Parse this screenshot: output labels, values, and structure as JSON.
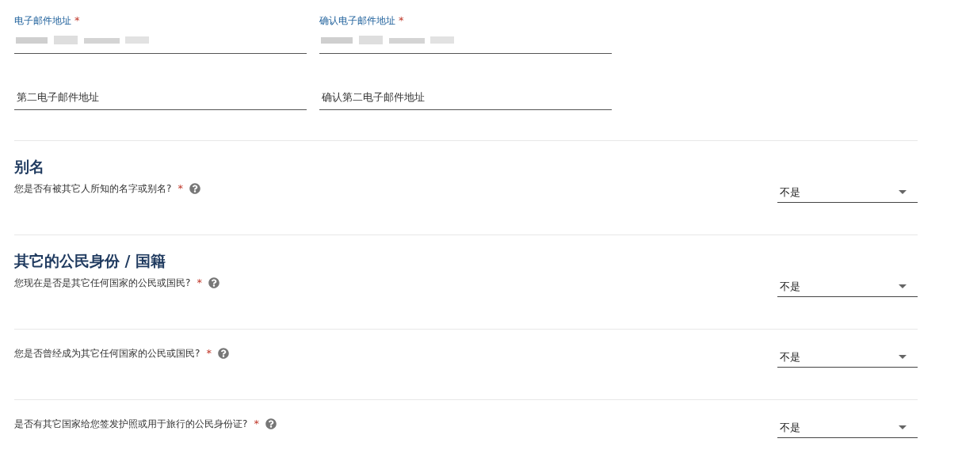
{
  "email_fields": [
    {
      "kind": "floating",
      "label": "电子邮件地址",
      "required_mark": "*"
    },
    {
      "kind": "floating",
      "label": "确认电子邮件地址",
      "required_mark": "*"
    },
    {
      "kind": "empty",
      "placeholder": "第二电子邮件地址"
    },
    {
      "kind": "empty",
      "placeholder": "确认第二电子邮件地址"
    }
  ],
  "blocks": [
    {
      "heading": "别名",
      "question": "您是否有被其它人所知的名字或别名?",
      "required_mark": "*",
      "select_value": "不是"
    },
    {
      "heading": "其它的公民身份 / 国籍",
      "question": "您现在是否是其它任何国家的公民或国民?",
      "required_mark": "*",
      "select_value": "不是"
    },
    {
      "question": "您是否曾经成为其它任何国家的公民或国民?",
      "required_mark": "*",
      "select_value": "不是"
    },
    {
      "question": "是否有其它国家给您签发护照或用于旅行的公民身份证?",
      "required_mark": "*",
      "select_value": "不是"
    }
  ]
}
